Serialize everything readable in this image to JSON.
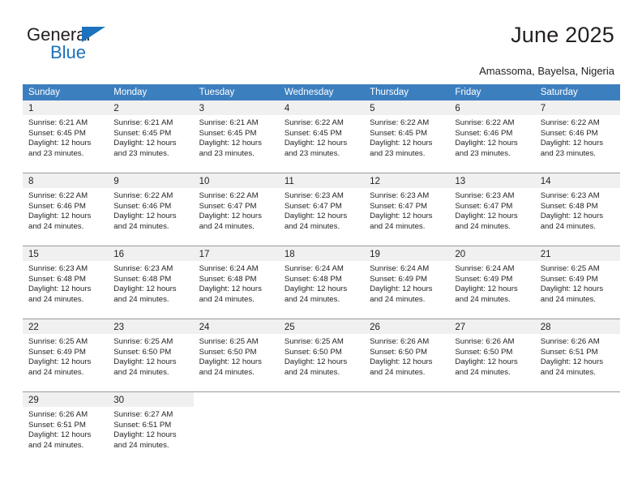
{
  "brand": {
    "name_top": "General",
    "name_bottom": "Blue",
    "triangle_color": "#1c72bc",
    "text_color": "#231f20",
    "accent_color": "#1c72bc"
  },
  "header": {
    "title": "June 2025",
    "location": "Amassoma, Bayelsa, Nigeria"
  },
  "calendar": {
    "header_bg": "#3c7fbf",
    "header_text_color": "#ffffff",
    "daynum_band_bg": "#f0f0f0",
    "grid_line_color": "#9a9a9a",
    "weekdays": [
      "Sunday",
      "Monday",
      "Tuesday",
      "Wednesday",
      "Thursday",
      "Friday",
      "Saturday"
    ],
    "weeks": [
      [
        {
          "day": "1",
          "sunrise": "Sunrise: 6:21 AM",
          "sunset": "Sunset: 6:45 PM",
          "daylight_1": "Daylight: 12 hours",
          "daylight_2": "and 23 minutes."
        },
        {
          "day": "2",
          "sunrise": "Sunrise: 6:21 AM",
          "sunset": "Sunset: 6:45 PM",
          "daylight_1": "Daylight: 12 hours",
          "daylight_2": "and 23 minutes."
        },
        {
          "day": "3",
          "sunrise": "Sunrise: 6:21 AM",
          "sunset": "Sunset: 6:45 PM",
          "daylight_1": "Daylight: 12 hours",
          "daylight_2": "and 23 minutes."
        },
        {
          "day": "4",
          "sunrise": "Sunrise: 6:22 AM",
          "sunset": "Sunset: 6:45 PM",
          "daylight_1": "Daylight: 12 hours",
          "daylight_2": "and 23 minutes."
        },
        {
          "day": "5",
          "sunrise": "Sunrise: 6:22 AM",
          "sunset": "Sunset: 6:45 PM",
          "daylight_1": "Daylight: 12 hours",
          "daylight_2": "and 23 minutes."
        },
        {
          "day": "6",
          "sunrise": "Sunrise: 6:22 AM",
          "sunset": "Sunset: 6:46 PM",
          "daylight_1": "Daylight: 12 hours",
          "daylight_2": "and 23 minutes."
        },
        {
          "day": "7",
          "sunrise": "Sunrise: 6:22 AM",
          "sunset": "Sunset: 6:46 PM",
          "daylight_1": "Daylight: 12 hours",
          "daylight_2": "and 23 minutes."
        }
      ],
      [
        {
          "day": "8",
          "sunrise": "Sunrise: 6:22 AM",
          "sunset": "Sunset: 6:46 PM",
          "daylight_1": "Daylight: 12 hours",
          "daylight_2": "and 24 minutes."
        },
        {
          "day": "9",
          "sunrise": "Sunrise: 6:22 AM",
          "sunset": "Sunset: 6:46 PM",
          "daylight_1": "Daylight: 12 hours",
          "daylight_2": "and 24 minutes."
        },
        {
          "day": "10",
          "sunrise": "Sunrise: 6:22 AM",
          "sunset": "Sunset: 6:47 PM",
          "daylight_1": "Daylight: 12 hours",
          "daylight_2": "and 24 minutes."
        },
        {
          "day": "11",
          "sunrise": "Sunrise: 6:23 AM",
          "sunset": "Sunset: 6:47 PM",
          "daylight_1": "Daylight: 12 hours",
          "daylight_2": "and 24 minutes."
        },
        {
          "day": "12",
          "sunrise": "Sunrise: 6:23 AM",
          "sunset": "Sunset: 6:47 PM",
          "daylight_1": "Daylight: 12 hours",
          "daylight_2": "and 24 minutes."
        },
        {
          "day": "13",
          "sunrise": "Sunrise: 6:23 AM",
          "sunset": "Sunset: 6:47 PM",
          "daylight_1": "Daylight: 12 hours",
          "daylight_2": "and 24 minutes."
        },
        {
          "day": "14",
          "sunrise": "Sunrise: 6:23 AM",
          "sunset": "Sunset: 6:48 PM",
          "daylight_1": "Daylight: 12 hours",
          "daylight_2": "and 24 minutes."
        }
      ],
      [
        {
          "day": "15",
          "sunrise": "Sunrise: 6:23 AM",
          "sunset": "Sunset: 6:48 PM",
          "daylight_1": "Daylight: 12 hours",
          "daylight_2": "and 24 minutes."
        },
        {
          "day": "16",
          "sunrise": "Sunrise: 6:23 AM",
          "sunset": "Sunset: 6:48 PM",
          "daylight_1": "Daylight: 12 hours",
          "daylight_2": "and 24 minutes."
        },
        {
          "day": "17",
          "sunrise": "Sunrise: 6:24 AM",
          "sunset": "Sunset: 6:48 PM",
          "daylight_1": "Daylight: 12 hours",
          "daylight_2": "and 24 minutes."
        },
        {
          "day": "18",
          "sunrise": "Sunrise: 6:24 AM",
          "sunset": "Sunset: 6:48 PM",
          "daylight_1": "Daylight: 12 hours",
          "daylight_2": "and 24 minutes."
        },
        {
          "day": "19",
          "sunrise": "Sunrise: 6:24 AM",
          "sunset": "Sunset: 6:49 PM",
          "daylight_1": "Daylight: 12 hours",
          "daylight_2": "and 24 minutes."
        },
        {
          "day": "20",
          "sunrise": "Sunrise: 6:24 AM",
          "sunset": "Sunset: 6:49 PM",
          "daylight_1": "Daylight: 12 hours",
          "daylight_2": "and 24 minutes."
        },
        {
          "day": "21",
          "sunrise": "Sunrise: 6:25 AM",
          "sunset": "Sunset: 6:49 PM",
          "daylight_1": "Daylight: 12 hours",
          "daylight_2": "and 24 minutes."
        }
      ],
      [
        {
          "day": "22",
          "sunrise": "Sunrise: 6:25 AM",
          "sunset": "Sunset: 6:49 PM",
          "daylight_1": "Daylight: 12 hours",
          "daylight_2": "and 24 minutes."
        },
        {
          "day": "23",
          "sunrise": "Sunrise: 6:25 AM",
          "sunset": "Sunset: 6:50 PM",
          "daylight_1": "Daylight: 12 hours",
          "daylight_2": "and 24 minutes."
        },
        {
          "day": "24",
          "sunrise": "Sunrise: 6:25 AM",
          "sunset": "Sunset: 6:50 PM",
          "daylight_1": "Daylight: 12 hours",
          "daylight_2": "and 24 minutes."
        },
        {
          "day": "25",
          "sunrise": "Sunrise: 6:25 AM",
          "sunset": "Sunset: 6:50 PM",
          "daylight_1": "Daylight: 12 hours",
          "daylight_2": "and 24 minutes."
        },
        {
          "day": "26",
          "sunrise": "Sunrise: 6:26 AM",
          "sunset": "Sunset: 6:50 PM",
          "daylight_1": "Daylight: 12 hours",
          "daylight_2": "and 24 minutes."
        },
        {
          "day": "27",
          "sunrise": "Sunrise: 6:26 AM",
          "sunset": "Sunset: 6:50 PM",
          "daylight_1": "Daylight: 12 hours",
          "daylight_2": "and 24 minutes."
        },
        {
          "day": "28",
          "sunrise": "Sunrise: 6:26 AM",
          "sunset": "Sunset: 6:51 PM",
          "daylight_1": "Daylight: 12 hours",
          "daylight_2": "and 24 minutes."
        }
      ],
      [
        {
          "day": "29",
          "sunrise": "Sunrise: 6:26 AM",
          "sunset": "Sunset: 6:51 PM",
          "daylight_1": "Daylight: 12 hours",
          "daylight_2": "and 24 minutes."
        },
        {
          "day": "30",
          "sunrise": "Sunrise: 6:27 AM",
          "sunset": "Sunset: 6:51 PM",
          "daylight_1": "Daylight: 12 hours",
          "daylight_2": "and 24 minutes."
        },
        {
          "day": "",
          "sunrise": "",
          "sunset": "",
          "daylight_1": "",
          "daylight_2": ""
        },
        {
          "day": "",
          "sunrise": "",
          "sunset": "",
          "daylight_1": "",
          "daylight_2": ""
        },
        {
          "day": "",
          "sunrise": "",
          "sunset": "",
          "daylight_1": "",
          "daylight_2": ""
        },
        {
          "day": "",
          "sunrise": "",
          "sunset": "",
          "daylight_1": "",
          "daylight_2": ""
        },
        {
          "day": "",
          "sunrise": "",
          "sunset": "",
          "daylight_1": "",
          "daylight_2": ""
        }
      ]
    ]
  }
}
